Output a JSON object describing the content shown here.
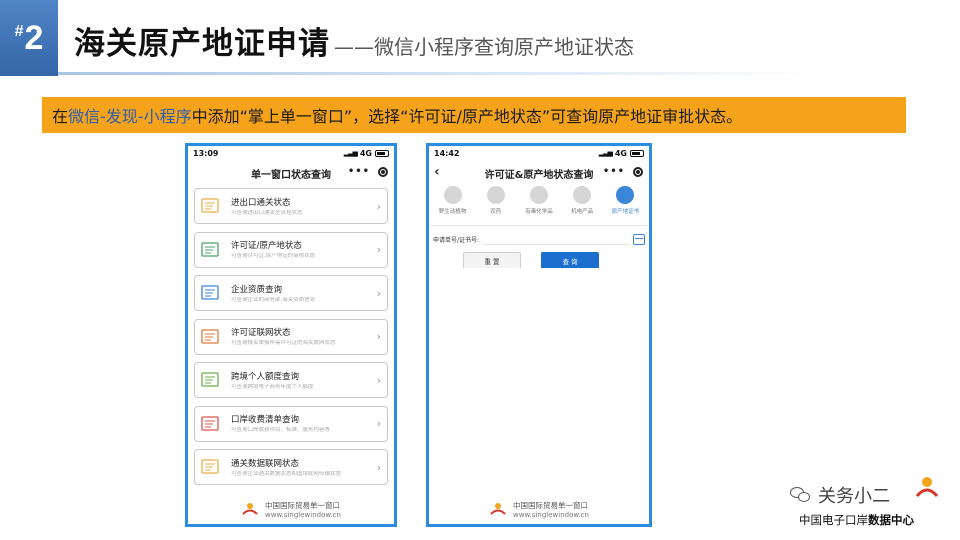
{
  "header": {
    "badge_hash": "#",
    "badge_number": "2",
    "title": "海关原产地证申请",
    "dash": "——",
    "subtitle": "微信小程序查询原产地证状态"
  },
  "banner": {
    "prefix": "在",
    "path": "微信-发现-小程序",
    "middle": "中添加“掌上单一窗口”，选择“许可证/原产地状态”可查询原产地证审批状态。"
  },
  "phone_left": {
    "time": "13:09",
    "network": "4G",
    "title": "单一窗口状态查询",
    "menu_dots": "•••",
    "items": [
      {
        "title": "进出口通关状态",
        "desc": "可查询进出口通关全流程状态"
      },
      {
        "title": "许可证/原产地状态",
        "desc": "可查询许可证,原产地证的审核状态"
      },
      {
        "title": "企业资质查询",
        "desc": "可查询企业的商务部,海关资质信息"
      },
      {
        "title": "许可证联网状态",
        "desc": "可查询报关单报所需许可证的海关联网状态"
      },
      {
        "title": "跨境个人额度查询",
        "desc": "可查询跨境电子商务年度个人额度"
      },
      {
        "title": "口岸收费清单查询",
        "desc": "可查询口岸收费项目、标准、服务内容等"
      },
      {
        "title": "通关数据联网状态",
        "desc": "可查询企业通关数据状态和国境联网传输状态"
      }
    ],
    "chevron": "›",
    "footer_cn": "中国国际贸易单一窗口",
    "footer_en": "www.singlewindow.cn"
  },
  "phone_right": {
    "time": "14:42",
    "network": "4G",
    "title": "许可证&原产地状态查询",
    "back": "‹",
    "menu_dots": "•••",
    "categories": [
      {
        "label": "野生动植物",
        "active": false
      },
      {
        "label": "农药",
        "active": false
      },
      {
        "label": "有毒化学品",
        "active": false
      },
      {
        "label": "机电产品",
        "active": false
      },
      {
        "label": "原产地证书",
        "active": true
      }
    ],
    "form_label": "申请单号/证书号:",
    "input_value": "",
    "reset_label": "重 置",
    "query_label": "查 询",
    "footer_cn": "中国国际贸易单一窗口",
    "footer_en": "www.singlewindow.cn"
  },
  "watermark": {
    "name": "关务小二",
    "org_prefix": "中国电子口岸",
    "org_bold": "数据中心"
  },
  "colors": {
    "badge_blue": "#3566a8",
    "banner_orange": "#f6a31c",
    "phone_border": "#2b8ce0",
    "query_button": "#1d6fcf"
  }
}
